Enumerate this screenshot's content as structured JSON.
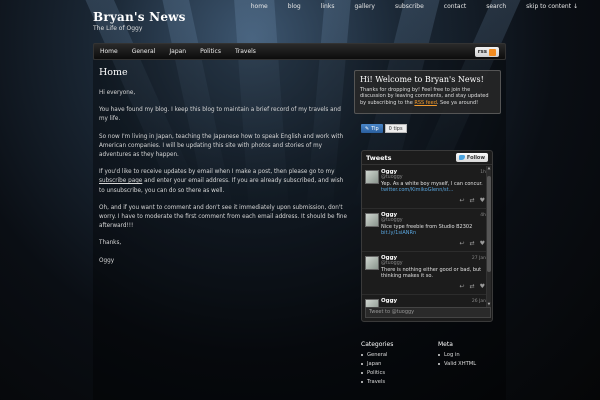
{
  "site": {
    "title": "Bryan's News",
    "tagline": "The Life of Oggy"
  },
  "top_nav": [
    "home",
    "blog",
    "links",
    "gallery",
    "subscribe",
    "contact",
    "search",
    "skip to content ↓"
  ],
  "main_nav": [
    "Home",
    "General",
    "Japan",
    "Politics",
    "Travels"
  ],
  "rss_label": "rss",
  "post": {
    "title": "Home",
    "greeting": "Hi everyone,",
    "p1": "You have found my blog. I keep this blog to maintain a brief record of my travels and my life.",
    "p2": "So now I'm living in Japan, teaching the Japanese how to speak English and work with American companies. I will be updating this site with photos and stories of my adventures as they happen.",
    "p3_pre": "If you'd like to receive updates by email when I make a post, then please go to my ",
    "p3_link": "subscribe page",
    "p3_post": " and enter your email address. If you are already subscribed, and wish to unsubscribe, you can do so there as well.",
    "p4": "Oh, and if you want to comment and don't see it immediately upon submission, don't worry. I have to moderate the first comment from each email address. It should be fine afterward!!!",
    "sign1": "Thanks,",
    "sign2": "Oggy"
  },
  "welcome": {
    "title": "Hi! Welcome to Bryan's News!",
    "text_pre": "Thanks for dropping by! Feel free to join the discussion by leaving comments, and stay updated by subscribing to the ",
    "link": "RSS feed",
    "text_post": ". See ya around!"
  },
  "tips": {
    "button": "Tip",
    "count": "0 tips"
  },
  "tweets": {
    "title": "Tweets",
    "follow": "Follow",
    "input_placeholder": "Tweet to @tuoggy",
    "items": [
      {
        "name": "Oggy",
        "handle": "@tuoggy",
        "time": "1h",
        "text": "Yep. As a white boy myself, I can concur.",
        "link": "twitter.com/KimikoGlenn/st..."
      },
      {
        "name": "Oggy",
        "handle": "@tuoggy",
        "time": "4h",
        "text": "Nice type freebie from Studio B2302",
        "link": "bit.ly/1siANRn"
      },
      {
        "name": "Oggy",
        "handle": "@tuoggy",
        "time": "27 Jan",
        "text": "There is nothing either good or bad, but thinking makes it so.",
        "link": ""
      },
      {
        "name": "Oggy",
        "handle": "@tuoggy",
        "time": "26 Jan",
        "text": "",
        "link": ""
      }
    ]
  },
  "categories": {
    "title": "Categories",
    "items": [
      "General",
      "Japan",
      "Politics",
      "Travels"
    ]
  },
  "meta": {
    "title": "Meta",
    "items": [
      "Log in",
      "Valid XHTML"
    ]
  }
}
